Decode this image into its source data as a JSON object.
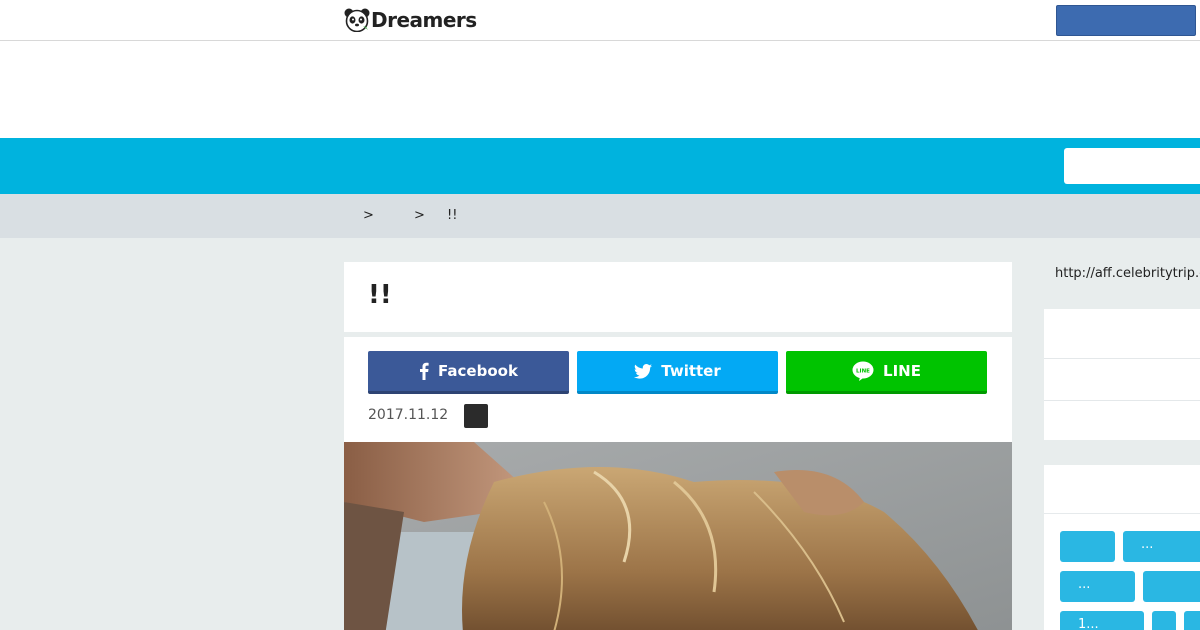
{
  "header": {
    "logo_text": "Dreamers",
    "logo_icon": "panda-icon",
    "header_button_label": ""
  },
  "nav": {
    "search_placeholder": ""
  },
  "breadcrumb": {
    "items": [
      "",
      "",
      "!!"
    ],
    "separators": [
      ">",
      ">"
    ]
  },
  "article": {
    "title": "!!",
    "date": "2017.11.12",
    "share": {
      "facebook": "Facebook",
      "twitter": "Twitter",
      "line": "LINE"
    }
  },
  "sidebar": {
    "affiliate_link": "http://aff.celebritytrip.c",
    "tags": [
      "",
      "...",
      "...",
      "",
      "1...",
      "",
      ""
    ]
  },
  "colors": {
    "nav": "#00b3de",
    "breadcrumb_bg": "#d9dfe3",
    "page_bg": "#e8eded",
    "facebook": "#3b5998",
    "twitter": "#03a9f4",
    "line": "#00c300",
    "tag": "#2ab7e3",
    "header_button": "#3d6bb0"
  }
}
